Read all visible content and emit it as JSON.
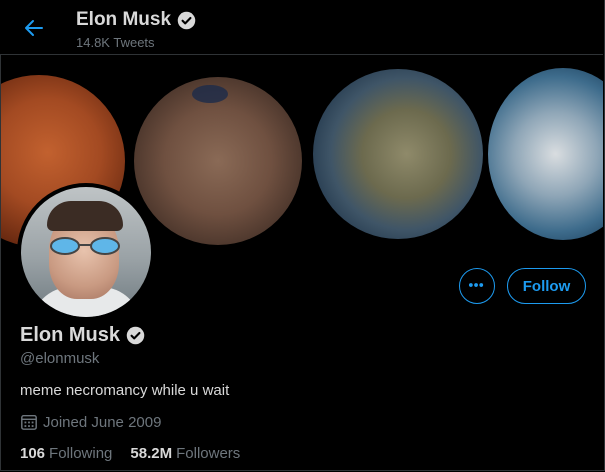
{
  "header": {
    "title": "Elon Musk",
    "tweet_count": "14.8K Tweets"
  },
  "profile": {
    "display_name": "Elon Musk",
    "handle": "@elonmusk",
    "bio": "meme necromancy while u wait",
    "joined": "Joined June 2009",
    "following_count": "106",
    "following_label": "Following",
    "followers_count": "58.2M",
    "followers_label": "Followers"
  },
  "actions": {
    "more_icon": "ellipsis-icon",
    "follow_label": "Follow"
  },
  "colors": {
    "accent": "#1d9bf0",
    "background": "#000000",
    "text": "#d9d9d9",
    "muted": "#6e767d"
  }
}
